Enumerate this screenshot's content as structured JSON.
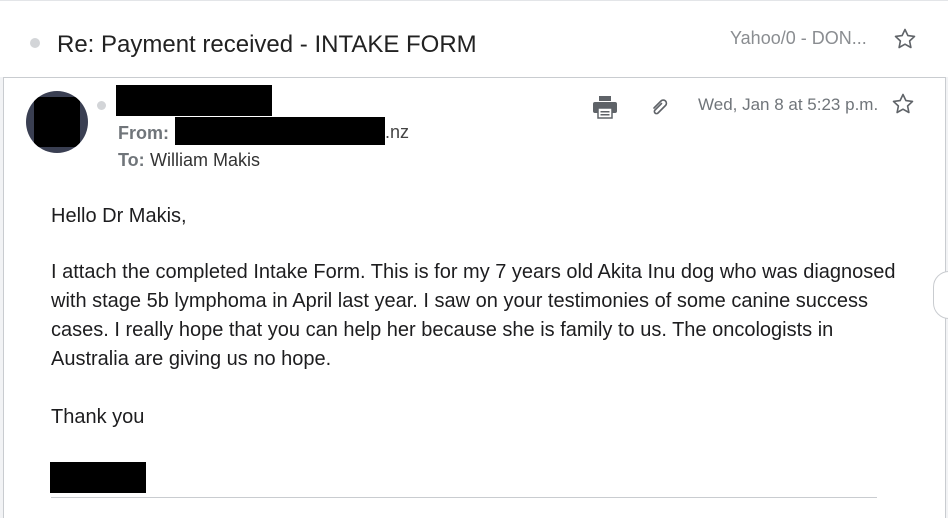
{
  "header": {
    "subject": "Re: Payment received - INTAKE FORM",
    "folder": "Yahoo/0 - DON..."
  },
  "message": {
    "from_label": "From:",
    "from_email_suffix": ".nz",
    "to_label": "To:",
    "to_name": "William Makis",
    "date": "Wed, Jan 8 at 5:23 p.m.",
    "greeting": "Hello Dr Makis,",
    "paragraph": "I attach the completed Intake Form. This is for my 7 years old Akita Inu dog who was diagnosed with stage 5b lymphoma in April last year. I saw on your testimonies of some canine success cases. I really hope that you can help her because she is family to us. The oncologists in Australia are giving us no hope.",
    "closing": "Thank you"
  },
  "icons": {
    "star": "star-icon",
    "print": "print-icon",
    "attachment": "paperclip-icon"
  },
  "colors": {
    "redaction": "#000000",
    "muted_text": "#70757a",
    "icon_gray": "#5f6368"
  }
}
